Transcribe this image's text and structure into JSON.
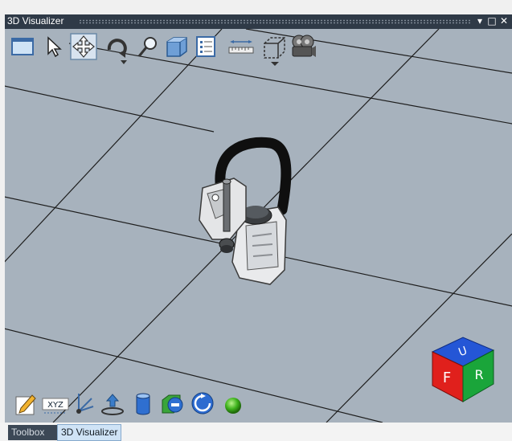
{
  "window": {
    "title": "3D Visualizer",
    "pin_glyph": "▾",
    "maximize_glyph": "□",
    "close_glyph": "✕"
  },
  "top_toolbar": {
    "tools": [
      "frame-view-icon",
      "select-pointer-icon",
      "pan-move-icon",
      "rotate-icon",
      "zoom-magnifier-icon",
      "solid-view-icon",
      "properties-list-icon",
      "measure-ruler-icon",
      "bounding-box-icon",
      "camera-settings-icon"
    ]
  },
  "bottom_toolbar": {
    "tools": [
      "edit-pencil-icon",
      "xyz-coordinates-icon",
      "axes-icon",
      "teach-point-icon",
      "cylinder-icon",
      "remove-object-icon",
      "reset-rotation-icon",
      "status-sphere-icon"
    ]
  },
  "view_cube": {
    "faces": {
      "top": "U",
      "front": "F",
      "right": "R"
    },
    "colors": {
      "top": "#2456d6",
      "front": "#e0201c",
      "right": "#1aa53a"
    }
  },
  "colors": {
    "titlebar": "#2f3a47",
    "viewport_bg": "#a7b2bd",
    "grid_line": "#1e1e1e",
    "tab_active": "#cfe3f6",
    "tab_inactive": "#3c4856"
  },
  "tabs": [
    {
      "label": "Toolbox",
      "active": false
    },
    {
      "label": "3D Visualizer",
      "active": true
    }
  ]
}
